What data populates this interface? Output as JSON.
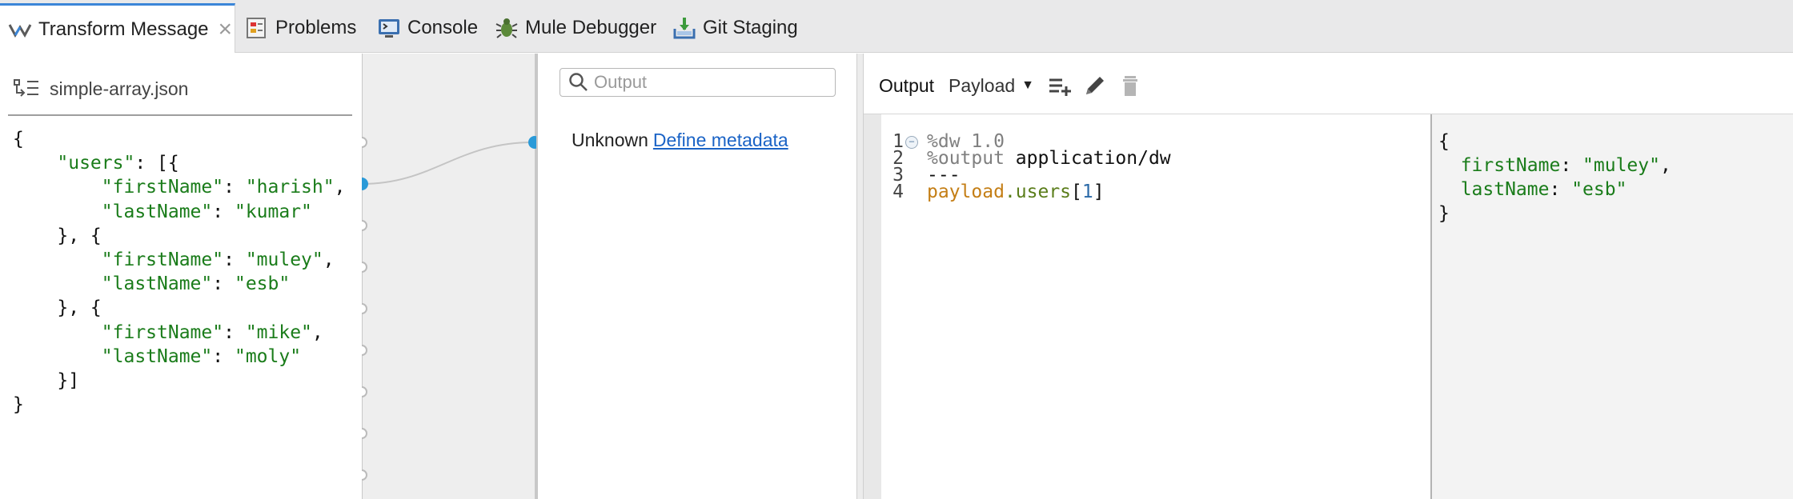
{
  "tabs": [
    {
      "label": "Transform Message",
      "icon": "dataweave-icon",
      "active": true
    },
    {
      "label": "Problems",
      "icon": "problems-icon"
    },
    {
      "label": "Console",
      "icon": "console-icon"
    },
    {
      "label": "Mule Debugger",
      "icon": "bug-icon"
    },
    {
      "label": "Git Staging",
      "icon": "git-staging-icon"
    }
  ],
  "input": {
    "file_name": "simple-array.json",
    "code_lines": [
      "{",
      "    \"users\": [{",
      "        \"firstName\": \"harish\",",
      "        \"lastName\": \"kumar\"",
      "    }, {",
      "        \"firstName\": \"muley\",",
      "        \"lastName\": \"esb\"",
      "    }, {",
      "        \"firstName\": \"mike\",",
      "        \"lastName\": \"moly\"",
      "    }]",
      "}"
    ]
  },
  "output_tree": {
    "search_placeholder": "Output",
    "unknown_label": "Unknown",
    "define_metadata_link": "Define metadata"
  },
  "script": {
    "output_label": "Output",
    "payload_select": "Payload",
    "lines": [
      {
        "num": "1",
        "parts": [
          {
            "t": "%dw 1.0",
            "c": "k-dir"
          }
        ]
      },
      {
        "num": "2",
        "parts": [
          {
            "t": "%output ",
            "c": "k-dir"
          },
          {
            "t": "application/dw",
            "c": "k-plain"
          }
        ]
      },
      {
        "num": "3",
        "parts": [
          {
            "t": "---",
            "c": "k-plain"
          }
        ]
      },
      {
        "num": "4",
        "parts": [
          {
            "t": "payload",
            "c": "k-pay"
          },
          {
            "t": ".users",
            "c": "k-prop"
          },
          {
            "t": "[",
            "c": "k-brk"
          },
          {
            "t": "1",
            "c": "k-num"
          },
          {
            "t": "]",
            "c": "k-brk"
          }
        ]
      }
    ]
  },
  "preview": {
    "lines": [
      [
        {
          "t": "{",
          "c": "p-punc"
        }
      ],
      [
        {
          "t": "  firstName",
          "c": "p-key"
        },
        {
          "t": ": ",
          "c": "p-punc"
        },
        {
          "t": "\"muley\"",
          "c": "p-str"
        },
        {
          "t": ",",
          "c": "p-punc"
        }
      ],
      [
        {
          "t": "  lastName",
          "c": "p-key"
        },
        {
          "t": ": ",
          "c": "p-punc"
        },
        {
          "t": "\"esb\"",
          "c": "p-str"
        }
      ],
      [
        {
          "t": "}",
          "c": "p-punc"
        }
      ]
    ]
  },
  "colors": {
    "accent": "#3b86d8",
    "mapping_dot": "#2a9ad8",
    "string_green": "#1a7c1a",
    "link_blue": "#1a63c6"
  }
}
